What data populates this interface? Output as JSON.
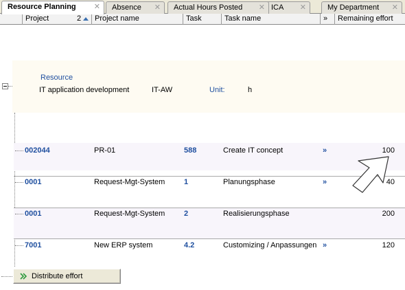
{
  "tabs": [
    {
      "label": "Resource Planning",
      "active": true
    },
    {
      "label": "Absence",
      "active": false
    },
    {
      "label": "Actual Hours Posted",
      "active": false
    },
    {
      "label": "ICA",
      "active": false
    },
    {
      "label": "My Department",
      "active": false
    }
  ],
  "tab_close_glyph": "✕",
  "columns": {
    "project": "Project",
    "sort_index": "2",
    "project_name": "Project name",
    "task": "Task",
    "task_name": "Task name",
    "more": "»",
    "remaining_effort": "Remaining effort"
  },
  "resource": {
    "heading": "Resource",
    "name": "IT application development",
    "code": "IT-AW",
    "unit_label": "Unit:",
    "unit_value": "h"
  },
  "rows": [
    {
      "project": "002044",
      "project_name": "PR-01",
      "task": "588",
      "task_name": "Create IT concept",
      "more": "»",
      "remaining": "100"
    },
    {
      "project": "0001",
      "project_name": "Request-Mgt-System",
      "task": "1",
      "task_name": "Planungsphase",
      "more": "»",
      "remaining": "40"
    },
    {
      "project": "0001",
      "project_name": "Request-Mgt-System",
      "task": "2",
      "task_name": "Realisierungsphase",
      "more": "»",
      "remaining": "200"
    },
    {
      "project": "7001",
      "project_name": "New ERP system",
      "task": "4.2",
      "task_name": "Customizing / Anpassungen",
      "more": "»",
      "remaining": "120"
    }
  ],
  "actions": {
    "distribute_effort": "Distribute effort"
  },
  "colors": {
    "link_blue": "#1f4f9f",
    "accent_green": "#2e9a3e"
  }
}
